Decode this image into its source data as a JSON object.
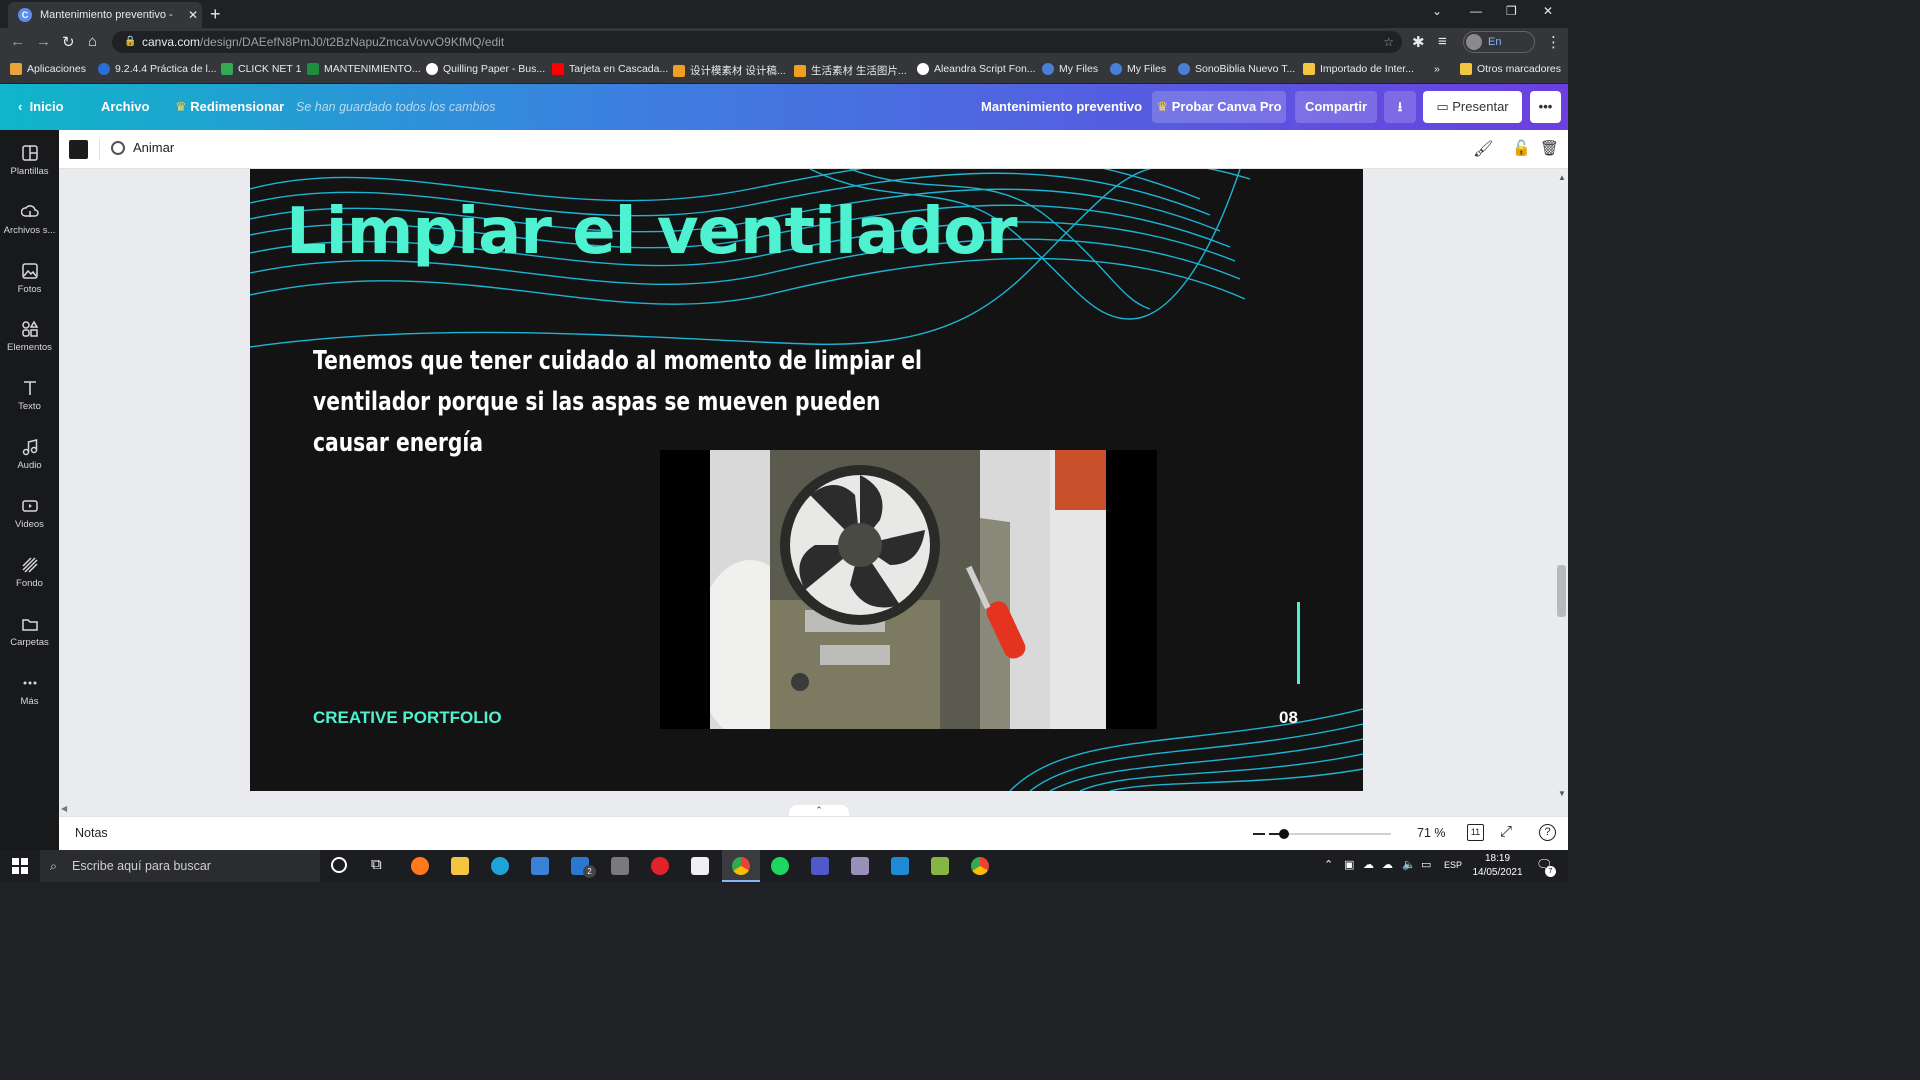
{
  "browser": {
    "tab_title": "Mantenimiento preventivo - Pres",
    "url_host": "canva.com",
    "url_path": "/design/DAEefN8PmJ0/t2BzNapuZmcaVovvO9KfMQ/edit",
    "profile_label": "En pausa",
    "bookmarks": [
      "Aplicaciones",
      "9.2.4.4 Práctica de l...",
      "CLICK NET 1",
      "MANTENIMIENTO...",
      "Quilling Paper - Bus...",
      "Tarjeta en Cascada...",
      "设计模素材 设计稿...",
      "生活素材 生活图片...",
      "Aleandra Script Fon...",
      "My Files",
      "My Files",
      "SonoBiblia Nuevo T...",
      "Importado de Inter...",
      "Otros marcadores"
    ],
    "bookmark_more": "»"
  },
  "header": {
    "home": "Inicio",
    "file": "Archivo",
    "resize": "Redimensionar",
    "saved_status": "Se han guardado todos los cambios",
    "doc_title": "Mantenimiento preventivo",
    "try_pro": "Probar Canva Pro",
    "share": "Compartir",
    "present": "Presentar",
    "more": "•••"
  },
  "sidebar": {
    "items": [
      {
        "label": "Plantillas",
        "icon": "templates-icon"
      },
      {
        "label": "Archivos s...",
        "icon": "upload-icon"
      },
      {
        "label": "Fotos",
        "icon": "photos-icon"
      },
      {
        "label": "Elementos",
        "icon": "elements-icon"
      },
      {
        "label": "Texto",
        "icon": "text-icon"
      },
      {
        "label": "Audio",
        "icon": "audio-icon"
      },
      {
        "label": "Videos",
        "icon": "videos-icon"
      },
      {
        "label": "Fondo",
        "icon": "background-icon"
      },
      {
        "label": "Carpetas",
        "icon": "folders-icon"
      },
      {
        "label": "Más",
        "icon": "more-icon"
      }
    ]
  },
  "toolbar": {
    "animate": "Animar",
    "color_swatch": "#1c1c1c"
  },
  "slide": {
    "title": "Limpiar el ventilador",
    "body": "Tenemos que tener cuidado al momento de limpiar el ventilador porque si las aspas se mueven pueden causar energía",
    "footer_left": "CREATIVE PORTFOLIO",
    "page_number": "08",
    "accent_color": "#4ef2d0",
    "background_color": "#131314"
  },
  "notes": {
    "label": "Notas",
    "zoom": "71 %",
    "page_count": "11",
    "zoom_level": 0.12
  },
  "taskbar": {
    "search_placeholder": "Escribe aquí para buscar",
    "mail_badge": "2",
    "language": "ESP",
    "time": "18:19",
    "date": "14/05/2021",
    "notification_count": "7"
  }
}
